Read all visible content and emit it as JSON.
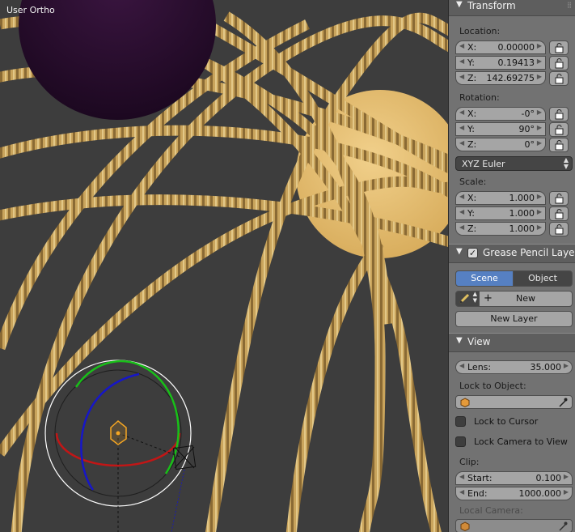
{
  "viewport": {
    "label": "User Ortho"
  },
  "panel": {
    "transform": {
      "title": "Transform",
      "location_label": "Location:",
      "location": [
        {
          "axis": "X:",
          "value": "0.00000"
        },
        {
          "axis": "Y:",
          "value": "0.19413"
        },
        {
          "axis": "Z:",
          "value": "142.69275"
        }
      ],
      "rotation_label": "Rotation:",
      "rotation": [
        {
          "axis": "X:",
          "value": "-0°"
        },
        {
          "axis": "Y:",
          "value": "90°"
        },
        {
          "axis": "Z:",
          "value": "0°"
        }
      ],
      "rotation_mode": "XYZ Euler",
      "scale_label": "Scale:",
      "scale": [
        {
          "axis": "X:",
          "value": "1.000"
        },
        {
          "axis": "Y:",
          "value": "1.000"
        },
        {
          "axis": "Z:",
          "value": "1.000"
        }
      ]
    },
    "grease_pencil": {
      "title": "Grease Pencil Layers",
      "tab_scene": "Scene",
      "tab_object": "Object",
      "new_label": "New",
      "new_layer_label": "New Layer"
    },
    "view": {
      "title": "View",
      "lens_label": "Lens:",
      "lens_value": "35.000",
      "lock_to_object_label": "Lock to Object:",
      "lock_to_cursor_label": "Lock to Cursor",
      "lock_camera_label": "Lock Camera to View",
      "clip_label": "Clip:",
      "clip_start_label": "Start:",
      "clip_start_value": "0.100",
      "clip_end_label": "End:",
      "clip_end_value": "1000.000",
      "local_camera_label": "Local Camera:"
    }
  },
  "colors": {
    "selected_tab": "#5680c2",
    "rope": "#c9a45c",
    "sun_sphere": "#e8c477",
    "dark_sphere": "#2a0f2e"
  }
}
